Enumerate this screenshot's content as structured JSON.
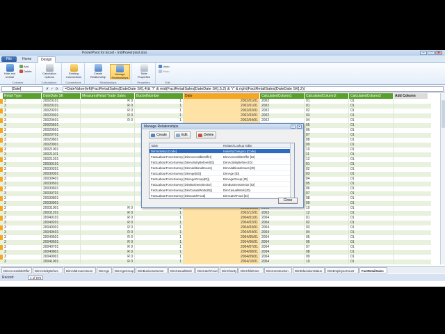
{
  "app": {
    "title": "PowerPivot for Excel - IndiPowerpivot.xlsx",
    "file_label": "File",
    "tabs": [
      "Home",
      "Design"
    ],
    "active_tab": "Design"
  },
  "ribbon": {
    "groups": [
      {
        "label": "Columns",
        "buttons": [
          {
            "label": "Hide and Unhide"
          }
        ],
        "small": [
          "Add",
          "Delete"
        ]
      },
      {
        "label": "Calculations",
        "buttons": [
          {
            "label": "Calculation Options"
          }
        ]
      },
      {
        "label": "Connections",
        "buttons": [
          {
            "label": "Existing Connections"
          }
        ]
      },
      {
        "label": "Relationships",
        "buttons": [
          {
            "label": "Create Relationship"
          },
          {
            "label": "Manage Relationships"
          }
        ]
      },
      {
        "label": "Properties",
        "buttons": [
          {
            "label": "Table Properties"
          }
        ]
      },
      {
        "label": "Edit",
        "small": [
          "Undo",
          "Redo"
        ]
      }
    ]
  },
  "formula_bar": {
    "name_box": "[Date]",
    "cancel": "✗",
    "ok": "✓",
    "fx": "fx",
    "formula": "=DateValue(left(FactRetailSales[DateDate SK],4)& \"/\" & mid(FactRetailSales[DateDate SK],5,2) & \"/\" & right(FactRetailSales[DateDate SK],2))"
  },
  "grid": {
    "columns": [
      "Retail Type",
      "DateDate SK",
      "MeasuresRetail Trade Sales",
      "BucketNumber",
      "Date",
      "CalculatedColumn1",
      "CalculatedColumn2",
      "CalculatedColumn3",
      "Add Column"
    ],
    "rows": [
      [
        "3",
        "20020101",
        "R 0",
        "1",
        "2002/01/01",
        "2002",
        "01",
        "01"
      ],
      [
        "3",
        "20020101",
        "R 0",
        "1",
        "2002/01/01",
        "2002",
        "01",
        "01"
      ],
      [
        "3",
        "20020201",
        "R 0",
        "1",
        "2002/02/01",
        "2002",
        "02",
        "01"
      ],
      [
        "3",
        "20020301",
        "R 0",
        "1",
        "2002/03/01",
        "2002",
        "03",
        "01"
      ],
      [
        "3",
        "20020401",
        "R 0",
        "1",
        "2002/04/01",
        "2002",
        "04",
        "01"
      ],
      [
        "3",
        "20020501",
        "",
        "",
        "",
        "",
        "05",
        "01"
      ],
      [
        "3",
        "20020601",
        "",
        "",
        "",
        "",
        "06",
        "01"
      ],
      [
        "3",
        "20020701",
        "",
        "",
        "",
        "",
        "07",
        "01"
      ],
      [
        "3",
        "20020801",
        "",
        "",
        "",
        "",
        "08",
        "01"
      ],
      [
        "3",
        "20020901",
        "",
        "",
        "",
        "",
        "09",
        "01"
      ],
      [
        "3",
        "20021001",
        "",
        "",
        "",
        "",
        "10",
        "01"
      ],
      [
        "3",
        "20021101",
        "",
        "",
        "",
        "",
        "11",
        "01"
      ],
      [
        "3",
        "20021201",
        "",
        "",
        "",
        "",
        "12",
        "01"
      ],
      [
        "3",
        "20030101",
        "",
        "",
        "",
        "",
        "01",
        "01"
      ],
      [
        "3",
        "20030201",
        "",
        "",
        "",
        "",
        "02",
        "01"
      ],
      [
        "3",
        "20030301",
        "",
        "",
        "",
        "",
        "03",
        "01"
      ],
      [
        "3",
        "20030401",
        "",
        "",
        "",
        "",
        "04",
        "01"
      ],
      [
        "3",
        "20030501",
        "",
        "",
        "",
        "",
        "05",
        "01"
      ],
      [
        "3",
        "20030601",
        "",
        "",
        "",
        "",
        "06",
        "01"
      ],
      [
        "3",
        "20030701",
        "",
        "",
        "",
        "",
        "07",
        "01"
      ],
      [
        "3",
        "20030801",
        "",
        "",
        "",
        "",
        "08",
        "01"
      ],
      [
        "3",
        "20030901",
        "",
        "",
        "",
        "",
        "09",
        "01"
      ],
      [
        "3",
        "20031001",
        "R 0",
        "1",
        "2003/10/01",
        "2003",
        "10",
        "01"
      ],
      [
        "3",
        "20031201",
        "R 0",
        "1",
        "2003/12/01",
        "2003",
        "12",
        "01"
      ],
      [
        "3",
        "20040101",
        "R 0",
        "1",
        "2004/01/01",
        "2004",
        "01",
        "01"
      ],
      [
        "3",
        "20040201",
        "R 0",
        "1",
        "2004/02/01",
        "2004",
        "02",
        "01"
      ],
      [
        "3",
        "20040301",
        "R 0",
        "1",
        "2004/03/01",
        "2004",
        "03",
        "01"
      ],
      [
        "3",
        "20040401",
        "R 0",
        "1",
        "2004/04/01",
        "2004",
        "04",
        "01"
      ],
      [
        "3",
        "20040501",
        "R 0",
        "1",
        "2004/05/01",
        "2004",
        "05",
        "01"
      ],
      [
        "3",
        "20040601",
        "R 0",
        "1",
        "2004/06/01",
        "2004",
        "06",
        "01"
      ],
      [
        "3",
        "20040701",
        "R 0",
        "1",
        "2004/07/01",
        "2004",
        "07",
        "01"
      ],
      [
        "3",
        "20040801",
        "R 0",
        "1",
        "2004/08/01",
        "2004",
        "08",
        "01"
      ],
      [
        "3",
        "20040901",
        "R 0",
        "1",
        "2004/09/01",
        "2004",
        "09",
        "01"
      ],
      [
        "3",
        "20041001",
        "R 0",
        "1",
        "2004/10/01",
        "2004",
        "10",
        "01"
      ]
    ]
  },
  "sheet_tabs": [
    "DimAccessibleOffer",
    "DimActivityBefore",
    "DimAddHoursHours",
    "DimAge",
    "DimAgeGroup",
    "DimBusinessSector",
    "DimCasualWork",
    "DimCatchFood",
    "DimCharity",
    "DimChildCare",
    "DimConstruction",
    "DimEducationStatus",
    "DimEmployeeCount",
    "FactRetailSales"
  ],
  "active_sheet": "FactRetailSales",
  "status": {
    "record_label": "Record:",
    "record_position": "1 of 870"
  },
  "dialog": {
    "title": "Manage Relationships",
    "buttons": [
      "Create",
      "Edit",
      "Delete"
    ],
    "columns": [
      "Table",
      "Related Lookup Table"
    ],
    "rows": [
      [
        "DimIndustry [Code]",
        "IndustryCategory [Code]"
      ],
      [
        "FactLabourForceSurvey [DimAccessibleOffer]",
        "DimAccessibleOffer [ID]"
      ],
      [
        "FactLabourForceSurvey [DimActivityBefore(ID)]",
        "DimActivityBefore [ID]"
      ],
      [
        "FactLabourForceSurvey [DimAdditionalHours]",
        "DimAdditionalHours [ID]"
      ],
      [
        "FactLabourForceSurvey [DimAge(ID)]",
        "DimAge [ID]"
      ],
      [
        "FactLabourForceSurvey [DimAgeGroup(ID)]",
        "DimAgeGroup [ID]"
      ],
      [
        "FactLabourForceSurvey [DimBusinessSector]",
        "DimBusinessSector [ID]"
      ],
      [
        "FactLabourForceSurvey [DimCasualWork(ID)]",
        "DimCasualWork [ID]"
      ],
      [
        "FactLabourForceSurvey [DimCatchFood]",
        "DimCatchFood [ID]"
      ]
    ],
    "close_label": "Close"
  },
  "colors": {
    "header_green": "#5aa02c",
    "selected_column": "#f5a623",
    "alt_row": "#e8f1de",
    "selection_blue": "#2e6bc2"
  }
}
